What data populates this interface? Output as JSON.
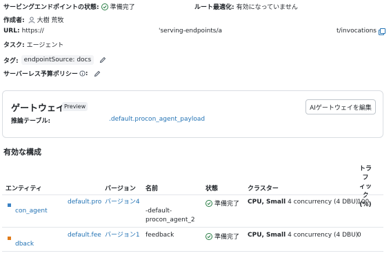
{
  "header": {
    "status_label": "サービングエンドポイントの状態:",
    "status_value": "準備完了",
    "route_label": "ルート最適化:",
    "route_value": "有効になっていません",
    "creator_label": "作成者:",
    "creator_value": "大樹 荒牧",
    "url_label": "URL:",
    "url_part1": "https://",
    "url_part2": "'serving-endpoints/a",
    "url_part3": "t/invocations",
    "task_label": "タスク:",
    "task_value": "エージェント",
    "tag_label": "タグ:",
    "tag_value": "endpointSource: docs",
    "budget_label": "サーバーレス予算ポリシー",
    "status_color": "#277c43"
  },
  "gateway": {
    "title": "ゲートウェイ",
    "badge": "Preview",
    "edit_button": "AIゲートウェイを編集",
    "table_label": "推論テーブル:",
    "table_value": ".default.procon_agent_payload"
  },
  "config": {
    "title": "有効な構成",
    "columns": {
      "entity": "エンティティ",
      "version": "バージョン",
      "name": "名前",
      "state": "状態",
      "cluster": "クラスター",
      "traffic_l1": "トラフ",
      "traffic_l2": "ィック",
      "traffic_l3": "(%)"
    },
    "rows": [
      {
        "entity_a": "default.pro",
        "entity_b": "con_agent",
        "version": "バージョン4",
        "name_a": "-default-",
        "name_b": "procon_agent_2",
        "state": "準備完了",
        "cluster_bold": "CPU, Small",
        "cluster_rest": "4 concurrency (4 DBU)",
        "traffic": "100",
        "color": "#3b82c4"
      },
      {
        "entity_a": "default.fee",
        "entity_b": "dback",
        "version": "バージョン1",
        "name_a": "feedback",
        "state": "準備完了",
        "cluster_bold": "CPU, Small",
        "cluster_rest": "4 concurrency (4 DBU)",
        "traffic": "0",
        "color": "#e07b1a"
      }
    ]
  }
}
